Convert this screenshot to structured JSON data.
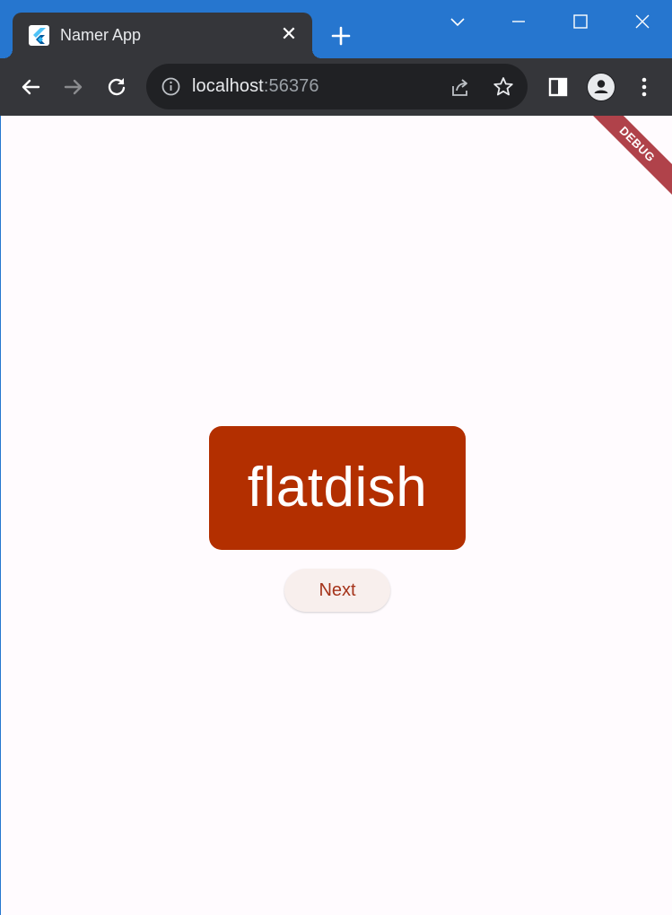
{
  "browser": {
    "tab": {
      "title": "Namer App",
      "close_glyph": "✕"
    },
    "new_tab_icon": "plus-icon",
    "url": {
      "host": "localhost",
      "port": ":56376"
    },
    "window_controls": [
      "chevron-down-icon",
      "minimize-icon",
      "maximize-icon",
      "close-icon"
    ]
  },
  "app": {
    "word": "flatdish",
    "next_label": "Next",
    "debug_banner": "DEBUG",
    "colors": {
      "card": "#b32f00",
      "button_text": "#a5331a",
      "background": "#fffbfe"
    }
  }
}
